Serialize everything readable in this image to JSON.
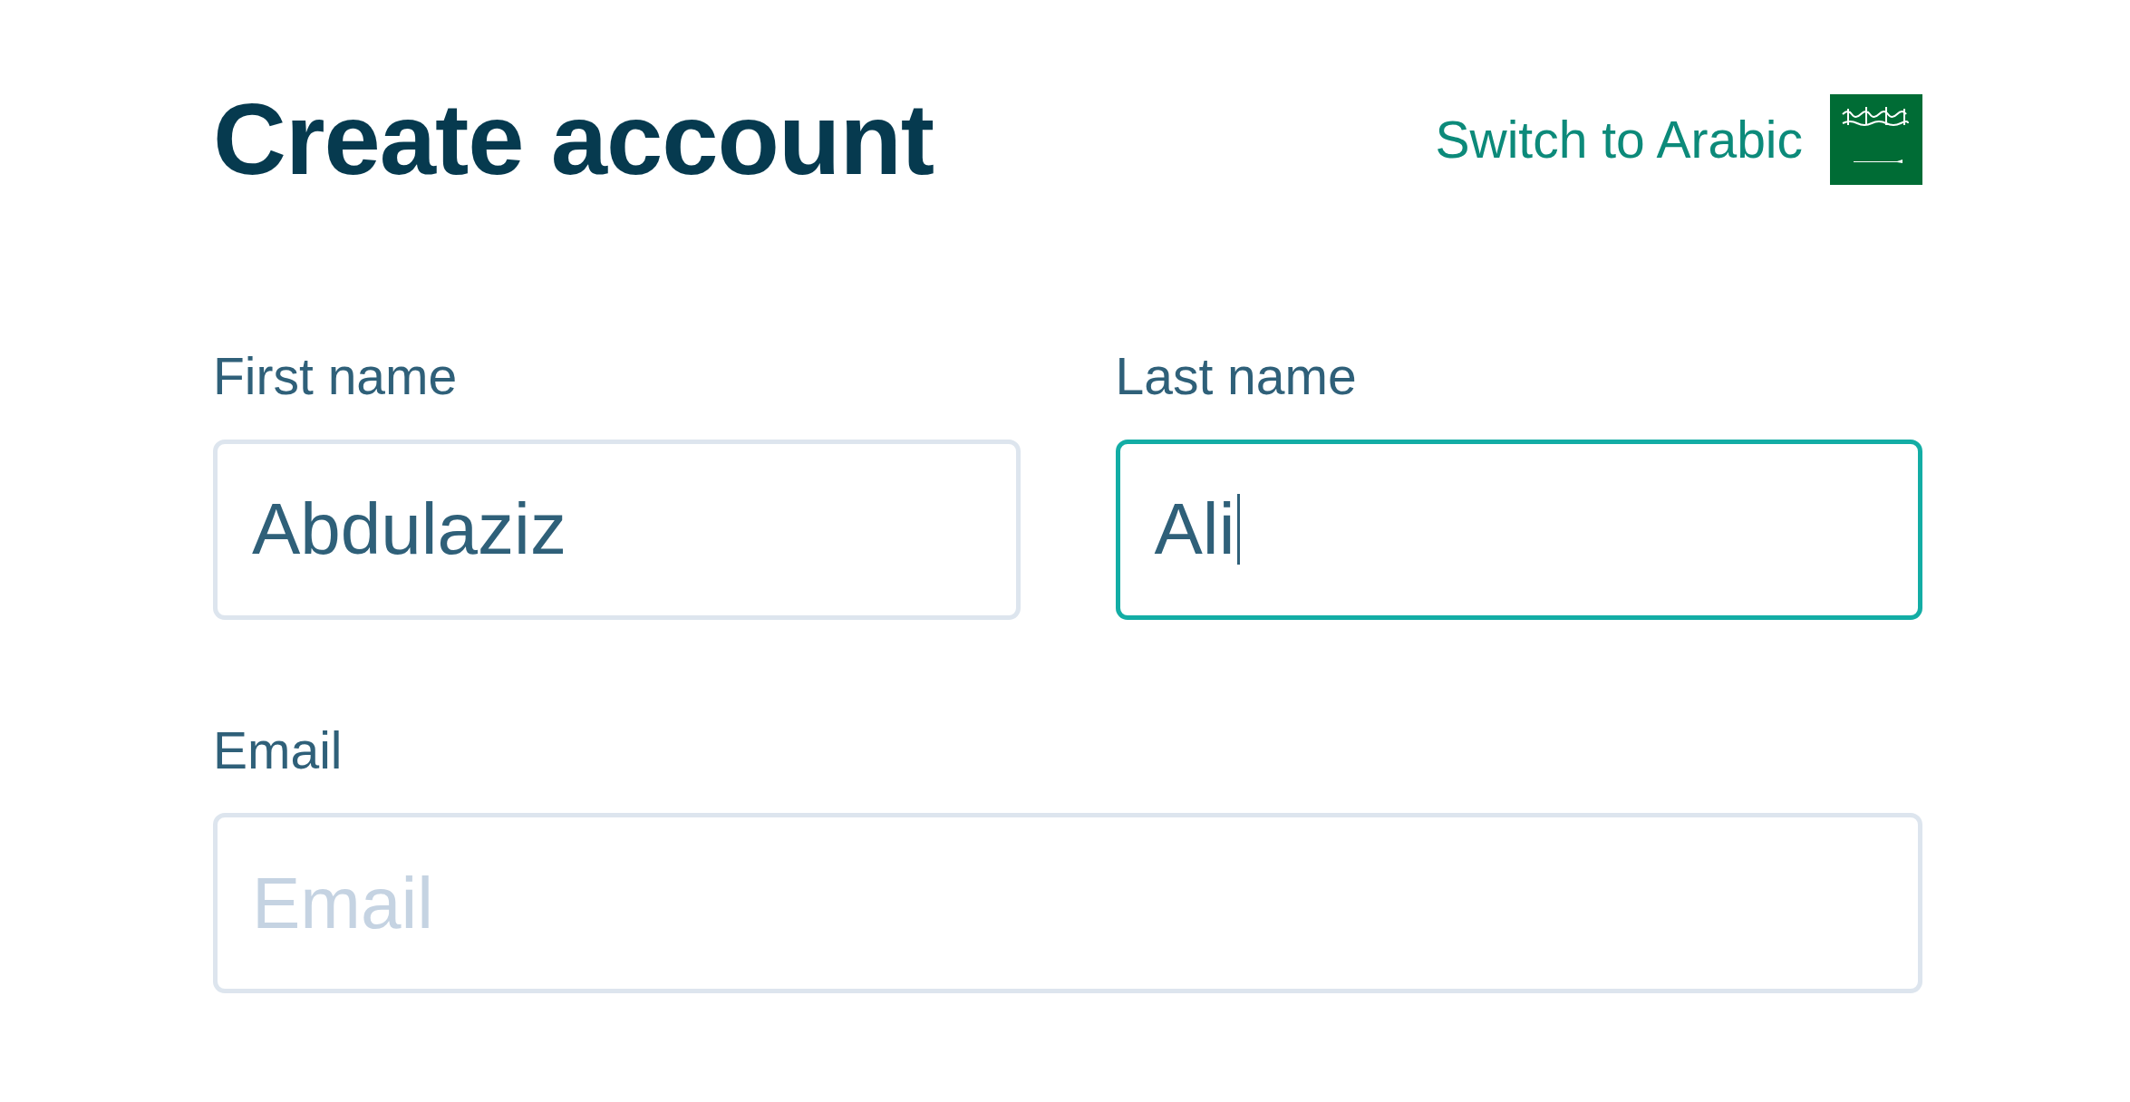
{
  "title": "Create account",
  "language_switch": {
    "label": "Switch to Arabic"
  },
  "name_fields": [
    {
      "label": "First name",
      "value": "Abdulaziz",
      "focused": false
    },
    {
      "label": "Last name",
      "value": "Ali",
      "focused": true
    }
  ],
  "email_field": {
    "label": "Email",
    "placeholder": "Email",
    "focused": false
  }
}
